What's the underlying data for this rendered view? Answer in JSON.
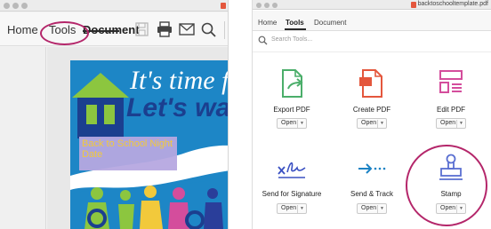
{
  "left_window": {
    "tabs": [
      {
        "label": "Home"
      },
      {
        "label": "Tools"
      },
      {
        "label": "Document"
      }
    ],
    "toolbar_icons": [
      "save-icon",
      "print-icon",
      "email-icon",
      "search-icon"
    ],
    "poster": {
      "line1": "It's time f",
      "line2": "Let's wal",
      "box_text": "Back to School Night Date"
    }
  },
  "right_window": {
    "filename": "backtoschooltemplate.pdf",
    "tabs": [
      {
        "label": "Home"
      },
      {
        "label": "Tools"
      },
      {
        "label": "Document"
      }
    ],
    "search_placeholder": "Search Tools...",
    "tools": [
      {
        "name": "Export PDF",
        "icon": "export-pdf-icon",
        "open_label": "Open",
        "color": "#4bae6a"
      },
      {
        "name": "Create PDF",
        "icon": "create-pdf-icon",
        "open_label": "Open",
        "color": "#e4573d"
      },
      {
        "name": "Edit PDF",
        "icon": "edit-pdf-icon",
        "open_label": "Open",
        "color": "#d44d9c"
      },
      {
        "name": "Send for Signature",
        "icon": "signature-icon",
        "open_label": "Open",
        "color": "#3a50c2"
      },
      {
        "name": "Send & Track",
        "icon": "send-track-icon",
        "open_label": "Open",
        "color": "#1b82c4"
      },
      {
        "name": "Stamp",
        "icon": "stamp-icon",
        "open_label": "Open",
        "color": "#5a6fd1"
      }
    ]
  },
  "highlight_color": "#b4266a"
}
